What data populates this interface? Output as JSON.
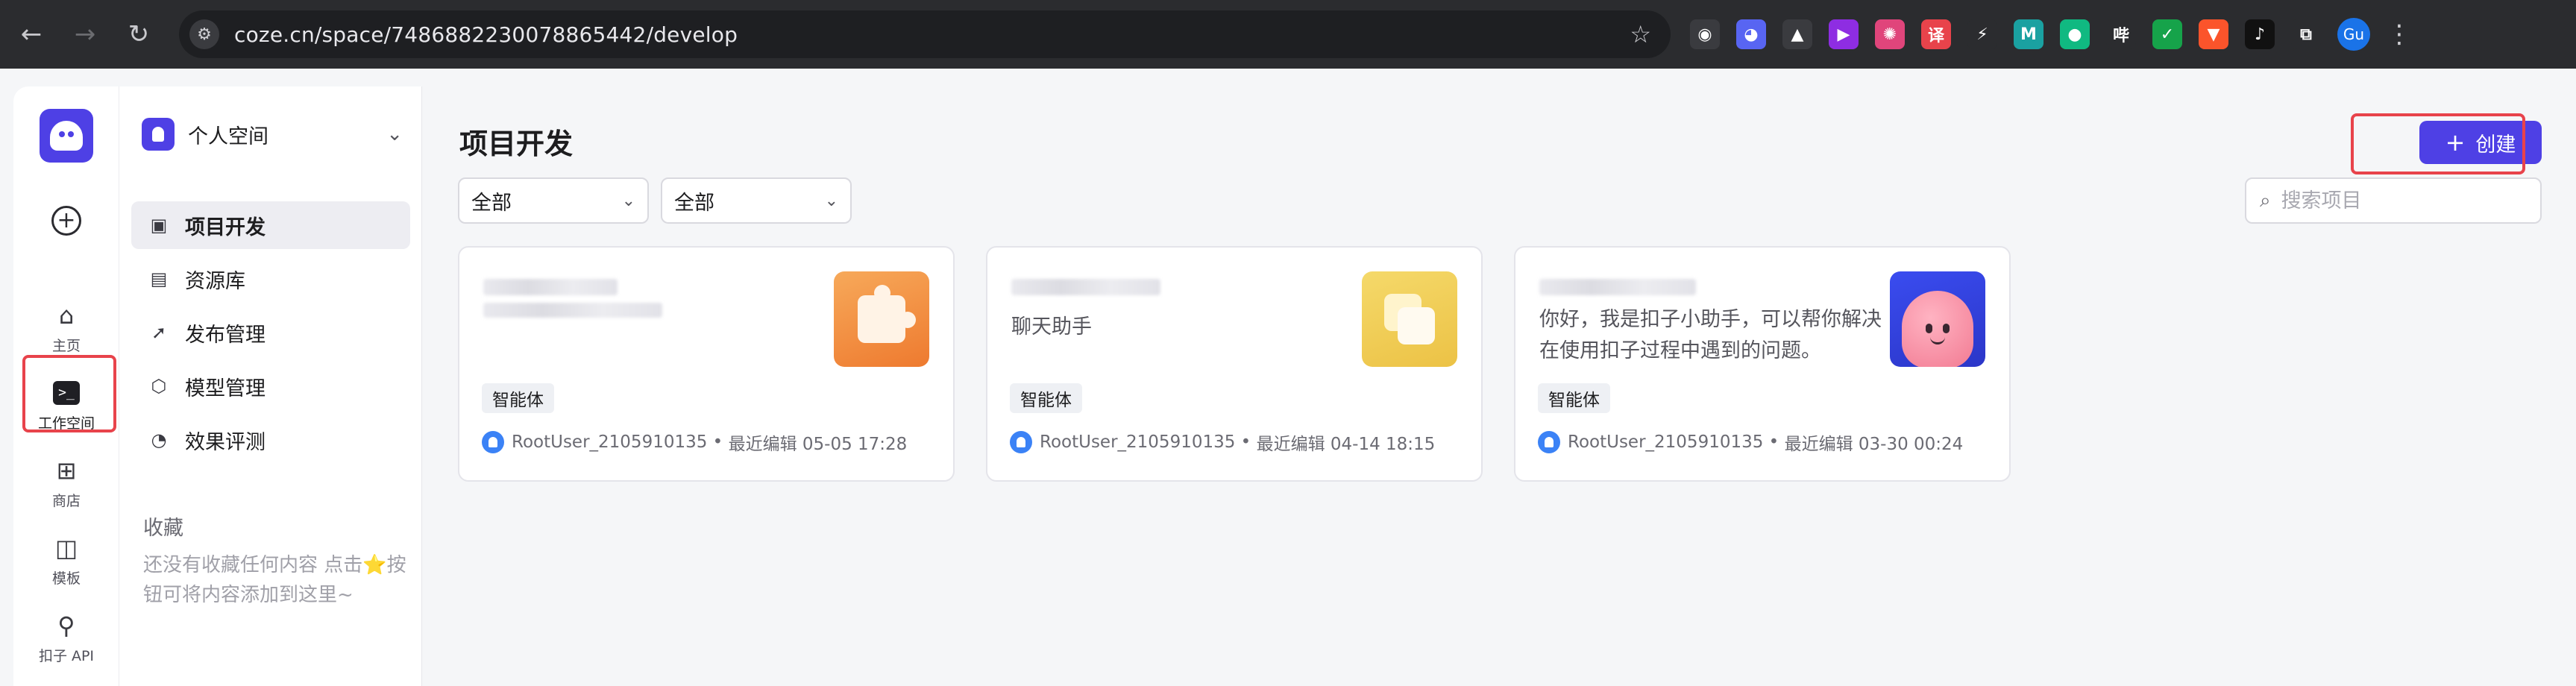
{
  "browser": {
    "back_icon": "←",
    "forward_icon": "→",
    "reload_icon": "↻",
    "url": "coze.cn/space/7486882230078865442/develop",
    "bookmark_icon": "☆",
    "extensions": [
      {
        "name": "openai-ext-icon",
        "glyph": "◉",
        "color": "#3a3b3f"
      },
      {
        "name": "discord-ext-icon",
        "glyph": "◕",
        "color": "#5865f2"
      },
      {
        "name": "triangle-ext-icon",
        "glyph": "▲",
        "color": "#3a3b3f"
      },
      {
        "name": "play-ext-icon",
        "glyph": "▶",
        "color": "#8e2de2"
      },
      {
        "name": "chatgpt-ext-icon",
        "glyph": "✺",
        "color": "#e0457b"
      },
      {
        "name": "translate-ext-icon",
        "glyph": "译",
        "color": "#e8434b"
      },
      {
        "name": "bolt-ext-icon",
        "glyph": "⚡",
        "color": "#2b2c2f"
      },
      {
        "name": "m-ext-icon",
        "glyph": "M",
        "color": "#1aa1a1"
      },
      {
        "name": "chat-bubble-ext-icon",
        "glyph": "●",
        "color": "#10b981"
      },
      {
        "name": "bilibili-ext-icon",
        "glyph": "哔",
        "color": "#2b2c2f"
      },
      {
        "name": "check-ext-icon",
        "glyph": "✓",
        "color": "#16a34a"
      },
      {
        "name": "brave-ext-icon",
        "glyph": "▼",
        "color": "#fb542b"
      },
      {
        "name": "tiktok-ext-icon",
        "glyph": "♪",
        "color": "#111111"
      },
      {
        "name": "puzzle-ext-icon",
        "glyph": "⧉",
        "color": "#2b2c2f"
      }
    ],
    "profile_label": "Gu",
    "menu_icon": "⋮"
  },
  "rail": {
    "items": [
      {
        "label": "主页",
        "icon": "home-icon",
        "glyph": "⌂"
      },
      {
        "label": "工作空间",
        "icon": "terminal-icon",
        "glyph": ">_"
      },
      {
        "label": "商店",
        "icon": "store-icon",
        "glyph": "⊞"
      },
      {
        "label": "模板",
        "icon": "template-icon",
        "glyph": "◫"
      },
      {
        "label": "扣子 API",
        "icon": "api-icon",
        "glyph": "⚲"
      }
    ]
  },
  "space": {
    "name": "个人空间"
  },
  "menu": {
    "items": [
      {
        "label": "项目开发",
        "icon": "bot-icon",
        "glyph": "▣"
      },
      {
        "label": "资源库",
        "icon": "library-icon",
        "glyph": "▤"
      },
      {
        "label": "发布管理",
        "icon": "rocket-icon",
        "glyph": "➚"
      },
      {
        "label": "模型管理",
        "icon": "cube-icon",
        "glyph": "⬡"
      },
      {
        "label": "效果评测",
        "icon": "gauge-icon",
        "glyph": "◔"
      }
    ],
    "favorites_title": "收藏",
    "favorites_empty": "还没有收藏任何内容 点击⭐按钮可将内容添加到这里~"
  },
  "main": {
    "title": "项目开发",
    "create_label": "创建",
    "filters": [
      "全部",
      "全部"
    ],
    "search_placeholder": "搜索项目",
    "cards": [
      {
        "description": "",
        "tag": "智能体",
        "owner": "RootUser_2105910135",
        "edited": "最近编辑 05-05 17:28"
      },
      {
        "description": "聊天助手",
        "tag": "智能体",
        "owner": "RootUser_2105910135",
        "edited": "最近编辑 04-14 18:15"
      },
      {
        "description": "你好，我是扣子小助手，可以帮你解决在使用扣子过程中遇到的问题。",
        "tag": "智能体",
        "owner": "RootUser_2105910135",
        "edited": "最近编辑 03-30 00:24"
      }
    ]
  }
}
